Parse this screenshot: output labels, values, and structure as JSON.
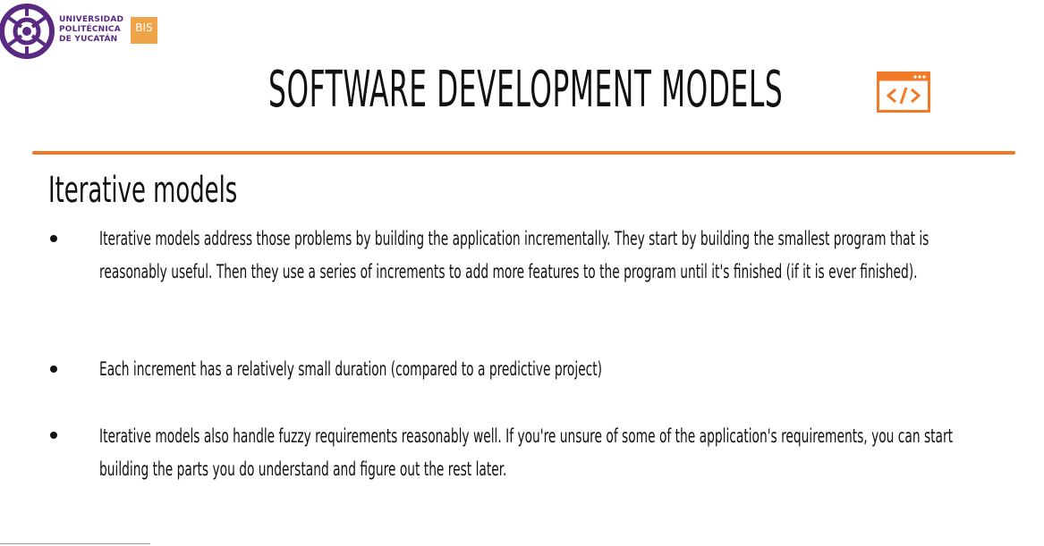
{
  "brand": {
    "university_lines": [
      "UNIVERSIDAD",
      "POLITÉCNICA",
      "DE YUCATÁN"
    ],
    "badge": "BIS",
    "colors": {
      "purple": "#5a2a82",
      "orange": "#f07a28",
      "badge_orange": "#f0a44a"
    }
  },
  "slide": {
    "title": "SOFTWARE DEVELOPMENT MODELS",
    "header_icon": "code-window-icon",
    "section_heading": "Iterative models",
    "bullets": [
      "Iterative models address those problems by building the application incrementally. They start by building the smallest program that is reasonably useful. Then they use a series of increments to add more features to the program until it's finished (if it is ever finished).",
      "Each increment has a relatively small duration (compared to a predictive project)",
      "Iterative models also handle fuzzy requirements reasonably well. If you're unsure of some of the application's requirements, you can start building the parts you do understand and figure out the rest later."
    ]
  }
}
